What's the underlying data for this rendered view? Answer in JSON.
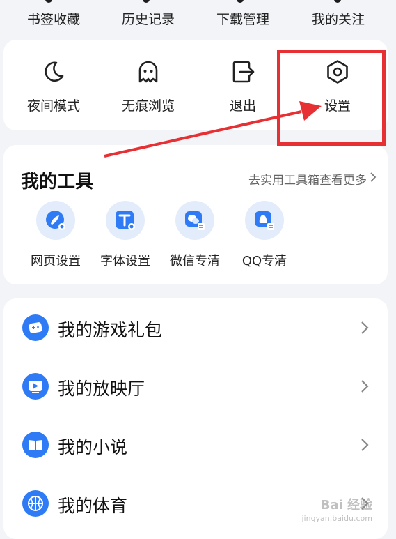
{
  "top_row": {
    "items": [
      "书签收藏",
      "历史记录",
      "下载管理",
      "我的关注"
    ]
  },
  "quick_actions": [
    {
      "label": "夜间模式",
      "icon": "moon-icon"
    },
    {
      "label": "无痕浏览",
      "icon": "ghost-icon"
    },
    {
      "label": "退出",
      "icon": "exit-icon"
    },
    {
      "label": "设置",
      "icon": "settings-hexagon-icon"
    }
  ],
  "tools": {
    "title": "我的工具",
    "more": "去实用工具箱查看更多",
    "items": [
      {
        "label": "网页设置",
        "icon": "webpage-settings-icon"
      },
      {
        "label": "字体设置",
        "icon": "font-settings-icon"
      },
      {
        "label": "微信专清",
        "icon": "wechat-clean-icon"
      },
      {
        "label": "QQ专清",
        "icon": "qq-clean-icon"
      }
    ]
  },
  "list": [
    {
      "label": "我的游戏礼包",
      "icon": "game-gift-icon"
    },
    {
      "label": "我的放映厅",
      "icon": "video-play-icon"
    },
    {
      "label": "我的小说",
      "icon": "book-icon"
    },
    {
      "label": "我的体育",
      "icon": "basketball-icon"
    }
  ],
  "colors": {
    "accent": "#2f7bf5",
    "annotation": "#e63033",
    "background": "#f2f4f7"
  },
  "watermark": {
    "text": "Bai 经验",
    "sub": "jingyan.baidu.com"
  }
}
